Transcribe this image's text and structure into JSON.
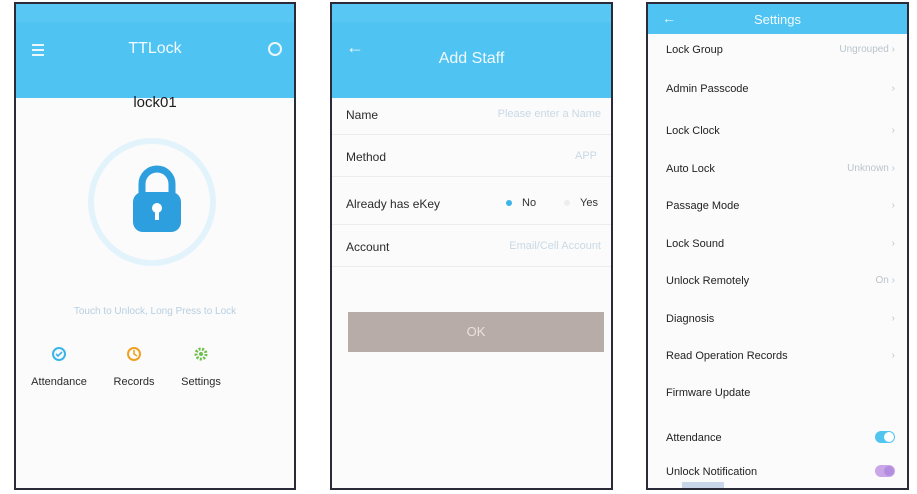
{
  "screens": {
    "home": {
      "app_title": "TTLock",
      "lock_name": "lock01",
      "hint": "Touch to Unlock, Long Press to Lock",
      "tools": [
        {
          "label": "Attendance",
          "icon": "attendance-icon",
          "color": "#3ab5ea"
        },
        {
          "label": "Records",
          "icon": "records-icon",
          "color": "#f0a020"
        },
        {
          "label": "Settings",
          "icon": "settings-icon",
          "color": "#6cc04a"
        }
      ]
    },
    "add_staff": {
      "title": "Add Staff",
      "name_label": "Name",
      "name_placeholder": "Please enter a Name",
      "method_label": "Method",
      "method_value": "APP",
      "ekey_label": "Already has eKey",
      "ekey_options": [
        "No",
        "Yes"
      ],
      "ekey_selected": "No",
      "account_label": "Account",
      "account_placeholder": "Email/Cell Account",
      "ok_label": "OK"
    },
    "settings": {
      "title": "Settings",
      "items": [
        {
          "label": "Lock Group",
          "value": "Ungrouped"
        },
        {
          "label": "Admin Passcode",
          "value": ""
        },
        {
          "label": "Lock Clock",
          "value": ""
        },
        {
          "label": "Auto Lock",
          "value": "Unknown"
        },
        {
          "label": "Passage Mode",
          "value": ""
        },
        {
          "label": "Lock Sound",
          "value": ""
        },
        {
          "label": "Unlock Remotely",
          "value": "On"
        },
        {
          "label": "Diagnosis",
          "value": ""
        },
        {
          "label": "Read Operation Records",
          "value": ""
        },
        {
          "label": "Firmware Update",
          "value": ""
        },
        {
          "label": "Attendance",
          "value": ""
        },
        {
          "label": "Unlock Notification",
          "value": ""
        }
      ],
      "attendance_toggle": true,
      "unlock_notification_toggle": true,
      "attendance_toggle_color": "#52c4f0",
      "notification_toggle_color": "#c8a6e8"
    }
  },
  "colors": {
    "accent": "#4fc3f2",
    "lock_blue": "#2d9fde"
  }
}
